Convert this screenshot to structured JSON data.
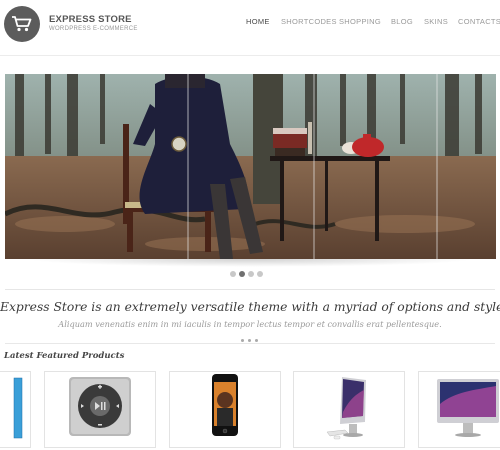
{
  "header": {
    "brand_title": "EXPRESS STORE",
    "brand_subtitle": "WORDPRESS E-COMMERCE",
    "logo_icon": "shopping-cart-icon",
    "nav": [
      {
        "label": "HOME",
        "active": true
      },
      {
        "label": "SHORTCODES",
        "active": false
      },
      {
        "label": "SHOPPING",
        "active": false
      },
      {
        "label": "BLOG",
        "active": false
      },
      {
        "label": "SKINS",
        "active": false
      },
      {
        "label": "CONTACTS",
        "active": false
      }
    ]
  },
  "slider": {
    "slide_count": 4,
    "active_slide": 2
  },
  "tagline": {
    "headline": "Express Store is an extremely versatile theme with a myriad of options and styles",
    "subline": "Aliquam venenatis enim in mi iaculis in tempor lectus tempor et convallis erat pellentesque."
  },
  "featured": {
    "title": "Latest Featured Products",
    "products": [
      {
        "icon": "product-partial-icon"
      },
      {
        "icon": "ipod-shuffle-icon"
      },
      {
        "icon": "iphone-icon"
      },
      {
        "icon": "imac-icon"
      },
      {
        "icon": "imac-large-icon"
      }
    ]
  },
  "colors": {
    "logo_bg": "#5c5c5c",
    "nav_active": "#4a4a4a",
    "nav_inactive": "#9a9a9a",
    "dot_active": "#707070",
    "dot_inactive": "#c8c8c8"
  }
}
